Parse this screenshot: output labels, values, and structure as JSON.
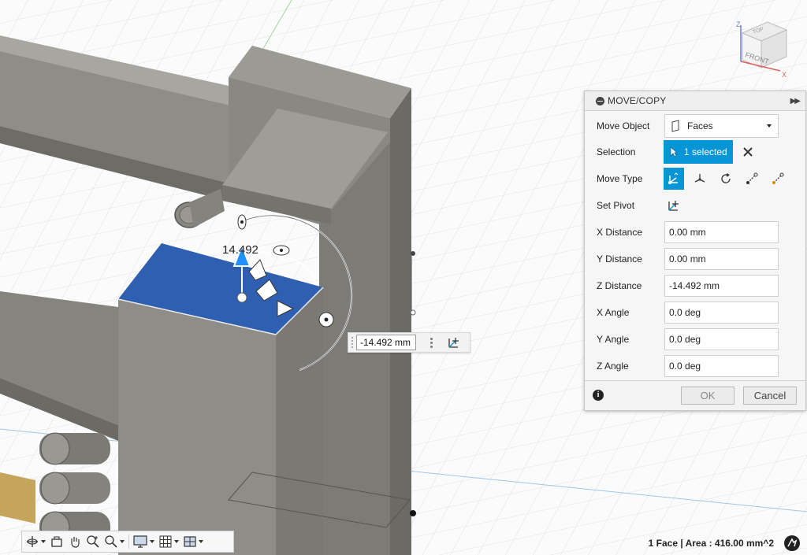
{
  "viewcube": {
    "top_label": "TOP",
    "front_label": "FRONT",
    "axis_z": "Z",
    "axis_x": "X"
  },
  "manipulator": {
    "distance_label": "14.492"
  },
  "dimension_input": {
    "value": "-14.492 mm"
  },
  "panel": {
    "title": "MOVE/COPY",
    "move_object": {
      "label": "Move Object",
      "value": "Faces"
    },
    "selection": {
      "label": "Selection",
      "value": "1 selected"
    },
    "move_type": {
      "label": "Move Type"
    },
    "set_pivot": {
      "label": "Set Pivot"
    },
    "x_distance": {
      "label": "X Distance",
      "value": "0.00 mm"
    },
    "y_distance": {
      "label": "Y Distance",
      "value": "0.00 mm"
    },
    "z_distance": {
      "label": "Z Distance",
      "value": "-14.492 mm"
    },
    "x_angle": {
      "label": "X Angle",
      "value": "0.0 deg"
    },
    "y_angle": {
      "label": "Y Angle",
      "value": "0.0 deg"
    },
    "z_angle": {
      "label": "Z Angle",
      "value": "0.0 deg"
    },
    "ok_label": "OK",
    "cancel_label": "Cancel",
    "info_glyph": "i"
  },
  "status": {
    "text": "1 Face | Area : 416.00 mm^2"
  },
  "colors": {
    "accent": "#0696d7",
    "selected_face": "#2f5fb0",
    "body_gray": "#8e8c86"
  },
  "icons": {
    "move_type": [
      "free-move-icon",
      "translate-xyz-icon",
      "rotate-icon",
      "point-to-point-icon",
      "point-to-position-icon"
    ],
    "toolbar": [
      "orbit-icon",
      "look-at-icon",
      "pan-icon",
      "zoom-icon",
      "fit-icon",
      "display-settings-icon",
      "grid-icon",
      "viewports-icon"
    ]
  }
}
